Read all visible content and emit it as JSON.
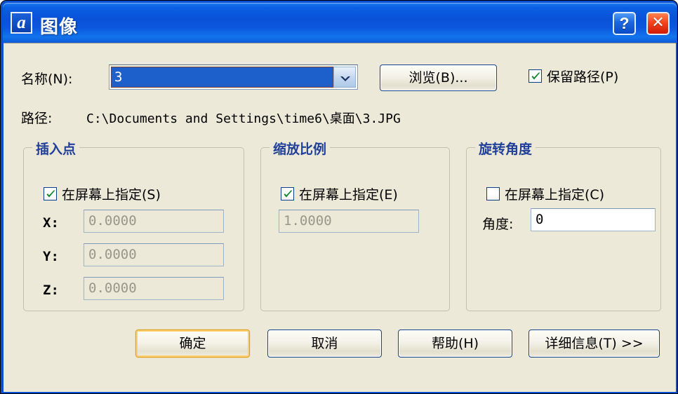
{
  "window": {
    "title": "图像",
    "app_icon": "a",
    "icon_name": "autocad-a-icon",
    "frame_color": "#0a4fd0",
    "client_bg": "#ece9d8",
    "titlebar_buttons": [
      {
        "name": "help-titlebar-button",
        "glyph": "?"
      },
      {
        "name": "close-titlebar-button",
        "glyph": "✕"
      }
    ]
  },
  "name_row": {
    "label": "名称(N):",
    "value": "3",
    "dropdown_icon": "chevron-down-icon",
    "browse_label": "浏览(B)...",
    "keep_path_label": "保留路径(P)",
    "keep_path_checked": true
  },
  "path_row": {
    "label": "路径:",
    "value": "C:\\Documents and Settings\\time6\\桌面\\3.JPG"
  },
  "insert_point": {
    "title": "插入点",
    "specify_label": "在屏幕上指定(S)",
    "specify_checked": true,
    "fields": [
      {
        "label": "X:",
        "value": "0.0000",
        "enabled": false
      },
      {
        "label": "Y:",
        "value": "0.0000",
        "enabled": false
      },
      {
        "label": "Z:",
        "value": "0.0000",
        "enabled": false
      }
    ]
  },
  "scale": {
    "title": "缩放比例",
    "specify_label": "在屏幕上指定(E)",
    "specify_checked": true,
    "value": "1.0000",
    "enabled": false
  },
  "rotation": {
    "title": "旋转角度",
    "specify_label": "在屏幕上指定(C)",
    "specify_checked": false,
    "angle_label": "角度:",
    "angle_value": "0",
    "enabled": true
  },
  "buttons": {
    "ok": "确定",
    "cancel": "取消",
    "help": "帮助(H)",
    "details": "详细信息(T) >>"
  },
  "colors": {
    "title_blue": "#0a52d8",
    "group_legend": "#21409a",
    "dialog_face": "#ece9d8",
    "default_button_glow": "#ffd070",
    "close_red": "#f4441c",
    "selection_blue": "#1d5fcb"
  }
}
